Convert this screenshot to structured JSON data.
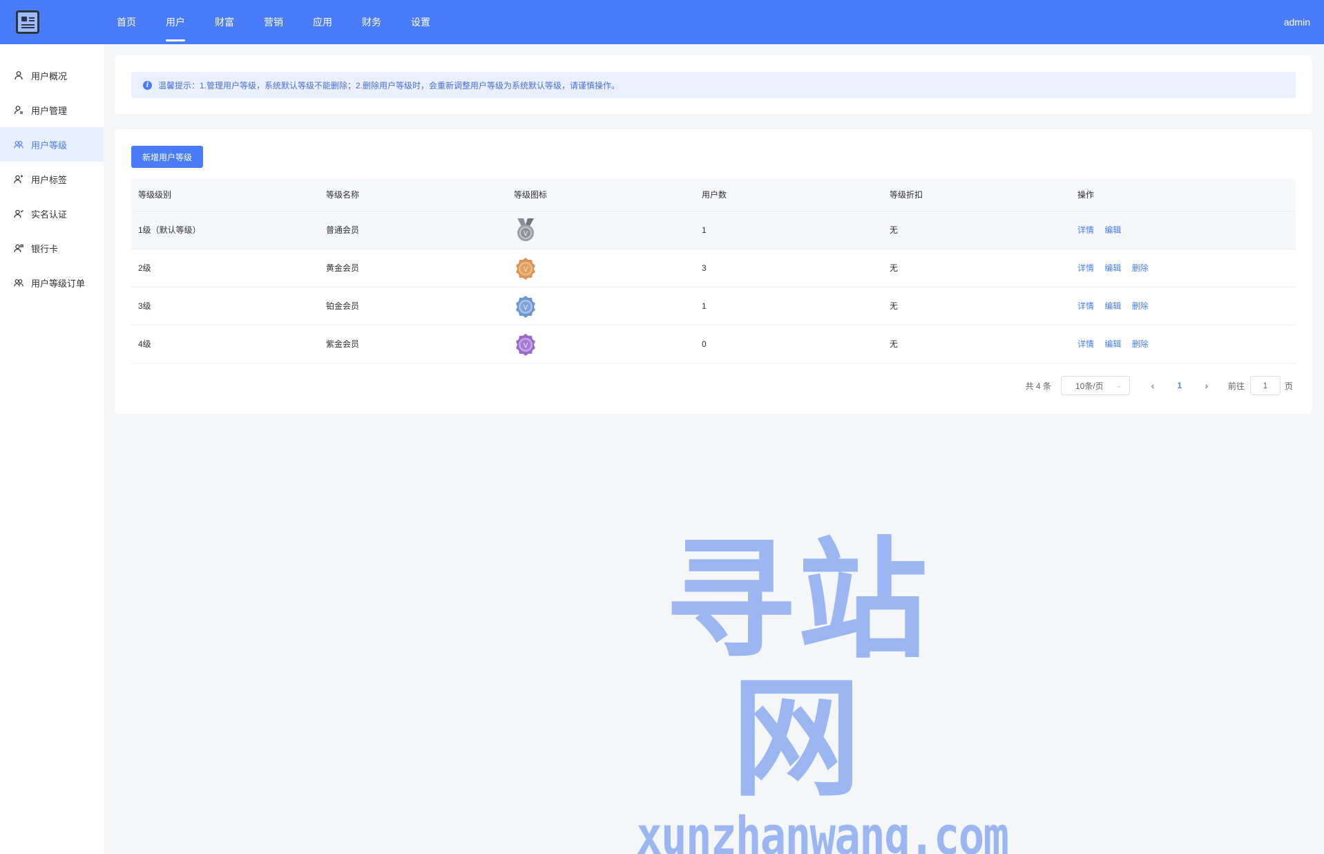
{
  "topbar": {
    "nav": [
      {
        "label": "首页",
        "active": false
      },
      {
        "label": "用户",
        "active": true
      },
      {
        "label": "财富",
        "active": false
      },
      {
        "label": "营销",
        "active": false
      },
      {
        "label": "应用",
        "active": false
      },
      {
        "label": "财务",
        "active": false
      },
      {
        "label": "设置",
        "active": false
      }
    ],
    "user": "admin",
    "accent_color": "#4a7cf9"
  },
  "sidebar": {
    "items": [
      {
        "label": "用户概况",
        "icon": "user-icon",
        "active": false
      },
      {
        "label": "用户管理",
        "icon": "user-manage-icon",
        "active": false
      },
      {
        "label": "用户等级",
        "icon": "users-icon",
        "active": true
      },
      {
        "label": "用户标签",
        "icon": "user-tag-icon",
        "active": false
      },
      {
        "label": "实名认证",
        "icon": "user-verify-icon",
        "active": false
      },
      {
        "label": "银行卡",
        "icon": "user-card-icon",
        "active": false
      },
      {
        "label": "用户等级订单",
        "icon": "users-order-icon",
        "active": false
      }
    ]
  },
  "notice": {
    "text": "温馨提示：1.管理用户等级，系统默认等级不能删除；2.删除用户等级时，会重新调整用户等级为系统默认等级，请谨慎操作。"
  },
  "toolbar": {
    "add_label": "新增用户等级"
  },
  "table": {
    "columns": [
      "等级级别",
      "等级名称",
      "等级图标",
      "用户数",
      "等级折扣",
      "操作"
    ],
    "rows": [
      {
        "level": "1级（默认等级）",
        "name": "普通会员",
        "medal": "silver",
        "users": "1",
        "discount": "无",
        "actions": [
          "详情",
          "编辑"
        ]
      },
      {
        "level": "2级",
        "name": "黄金会员",
        "medal": "gold",
        "users": "3",
        "discount": "无",
        "actions": [
          "详情",
          "编辑",
          "删除"
        ]
      },
      {
        "level": "3级",
        "name": "铂金会员",
        "medal": "blue",
        "users": "1",
        "discount": "无",
        "actions": [
          "详情",
          "编辑",
          "删除"
        ]
      },
      {
        "level": "4级",
        "name": "紫金会员",
        "medal": "purple",
        "users": "0",
        "discount": "无",
        "actions": [
          "详情",
          "编辑",
          "删除"
        ]
      }
    ]
  },
  "pagination": {
    "total": "共 4 条",
    "page_size": "10条/页",
    "current": "1",
    "goto_label": "前往",
    "goto_value": "1",
    "page_word": "页"
  },
  "watermark": {
    "cn": "寻站网",
    "en": "xunzhanwang.com"
  }
}
